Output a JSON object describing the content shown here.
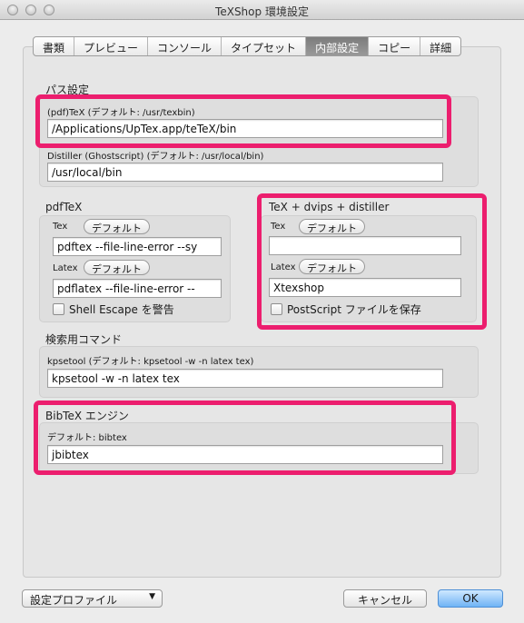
{
  "window": {
    "title": "TeXShop 環境設定"
  },
  "tabs": [
    {
      "label": "書類"
    },
    {
      "label": "プレビュー"
    },
    {
      "label": "コンソール"
    },
    {
      "label": "タイプセット"
    },
    {
      "label": "内部設定"
    },
    {
      "label": "コピー"
    },
    {
      "label": "詳細"
    }
  ],
  "paths": {
    "title": "パス設定",
    "tex_label": "(pdf)TeX (デフォルト: /usr/texbin)",
    "tex_value": "/Applications/UpTex.app/teTeX/bin",
    "distiller_label": "Distiller (Ghostscript) (デフォルト: /usr/local/bin)",
    "distiller_value": "/usr/local/bin"
  },
  "pdftex": {
    "title": "pdfTeX",
    "tex_label": "Tex",
    "default_label": "デフォルト",
    "tex_value": "pdftex --file-line-error --sy",
    "latex_label": "Latex",
    "latex_value": "pdflatex --file-line-error --",
    "shell_escape_label": "Shell Escape を警告"
  },
  "dvips": {
    "title": "TeX + dvips + distiller",
    "tex_label": "Tex",
    "default_label": "デフォルト",
    "tex_value": "",
    "latex_label": "Latex",
    "latex_value": "Xtexshop",
    "save_ps_label": "PostScript ファイルを保存"
  },
  "search": {
    "title": "検索用コマンド",
    "kpse_label": "kpsetool (デフォルト: kpsetool -w -n latex tex)",
    "kpse_value": "kpsetool -w -n latex tex"
  },
  "bibtex": {
    "title": "BibTeX エンジン",
    "default_label": "デフォルト: bibtex",
    "value": "jbibtex"
  },
  "footer": {
    "profile_label": "設定プロファイル",
    "cancel_label": "キャンセル",
    "ok_label": "OK"
  },
  "colors": {
    "highlight": "#ec1e6e",
    "ok_button": "#6fb3f5"
  }
}
